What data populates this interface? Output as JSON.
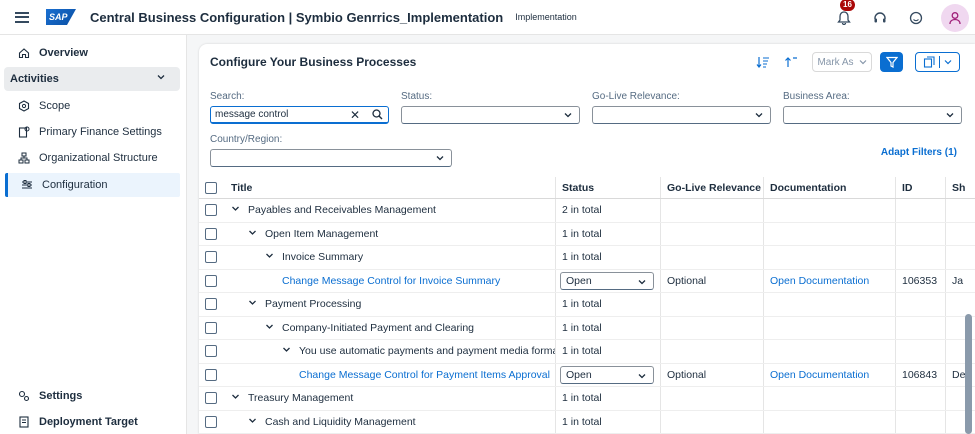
{
  "shell": {
    "logo": "SAP",
    "title": "Central Business Configuration | Symbio Genrrics_Implementation",
    "subtitle": "Implementation",
    "notifications_count": "16",
    "icons": [
      "menu-icon",
      "bell-icon",
      "headset-icon",
      "feedback-icon",
      "user-icon"
    ]
  },
  "sidenav": {
    "overview": "Overview",
    "activities": "Activities",
    "items": [
      {
        "label": "Scope",
        "icon": "scope-icon"
      },
      {
        "label": "Primary Finance Settings",
        "icon": "finance-settings-icon"
      },
      {
        "label": "Organizational Structure",
        "icon": "org-structure-icon"
      },
      {
        "label": "Configuration",
        "icon": "configuration-icon",
        "active": true
      }
    ],
    "settings": "Settings",
    "deployment_target": "Deployment Target"
  },
  "card": {
    "title": "Configure Your Business Processes",
    "mark_as": "Mark As",
    "adapt_filters": "Adapt Filters (1)"
  },
  "filters": {
    "search_label": "Search:",
    "search_value": "message control",
    "status_label": "Status:",
    "golive_label": "Go-Live Relevance:",
    "business_area_label": "Business Area:",
    "country_label": "Country/Region:"
  },
  "table": {
    "columns": [
      "Title",
      "Status",
      "Go-Live Relevance",
      "Documentation",
      "ID",
      "Sh"
    ],
    "rows": [
      {
        "indent": 0,
        "expand": true,
        "title": "Payables and Receivables Management",
        "status": "2 in total"
      },
      {
        "indent": 1,
        "expand": true,
        "title": "Open Item Management",
        "status": "1 in total"
      },
      {
        "indent": 2,
        "expand": true,
        "title": "Invoice Summary",
        "status": "1 in total"
      },
      {
        "indent": 3,
        "link": true,
        "title": "Change Message Control for Invoice Summary",
        "status_select": "Open",
        "golive": "Optional",
        "doc": "Open Documentation",
        "id": "106353",
        "sh": "Ja"
      },
      {
        "indent": 1,
        "expand": true,
        "title": "Payment Processing",
        "status": "1 in total"
      },
      {
        "indent": 2,
        "expand": true,
        "title": "Company-Initiated Payment and Clearing",
        "status": "1 in total"
      },
      {
        "indent": 3,
        "expand": true,
        "title": "You use automatic payments and payment media formats",
        "status": "1 in total"
      },
      {
        "indent": 4,
        "link": true,
        "title": "Change Message Control for Payment Items Approval",
        "status_select": "Open",
        "golive": "Optional",
        "doc": "Open Documentation",
        "id": "106843",
        "sh": "De"
      },
      {
        "indent": 0,
        "expand": true,
        "title": "Treasury Management",
        "status": "1 in total"
      },
      {
        "indent": 1,
        "expand": true,
        "title": "Cash and Liquidity Management",
        "status": "1 in total"
      }
    ]
  },
  "colors": {
    "accent": "#0a6ed1",
    "badge": "#aa0808",
    "text": "#1d2d3e"
  }
}
